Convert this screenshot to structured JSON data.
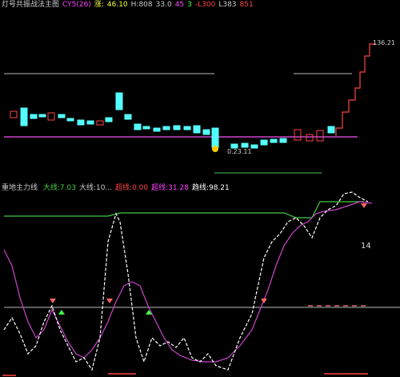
{
  "colors": {
    "background": "#000000",
    "up": "#ff4444",
    "down": "#54ffff",
    "purple": "#cc44cc",
    "green": "#44cc44",
    "white": "#ffffff",
    "yellow": "#ffff44"
  },
  "top_header": {
    "title": "灯号共振战法主图",
    "indicator": "CY5(26)",
    "up_label": "涨:",
    "up_value": "46.10",
    "ma_label": "H:808",
    "vol_label": "33.0",
    "ratio_label": "45",
    "ratio_value": "3",
    "neg_label": "-L300",
    "low_label": "L383",
    "extra": "851"
  },
  "top_price_labels": {
    "high": "136.21",
    "low": "0.23.11"
  },
  "bottom_header": {
    "title": "重地主力线",
    "fields": [
      {
        "label": "大线:",
        "value": "7.03",
        "color": "#44cc44"
      },
      {
        "label": "大线:",
        "value": "10...",
        "color": "#cccccc"
      },
      {
        "label": "超线:",
        "value": "0.00",
        "color": "#ff4444"
      },
      {
        "label": "超线:",
        "value": "31.28",
        "color": "#ff44ff"
      },
      {
        "label": "趋线:",
        "value": "98.21",
        "color": "#ffffff"
      }
    ]
  },
  "sub_label": "14"
}
